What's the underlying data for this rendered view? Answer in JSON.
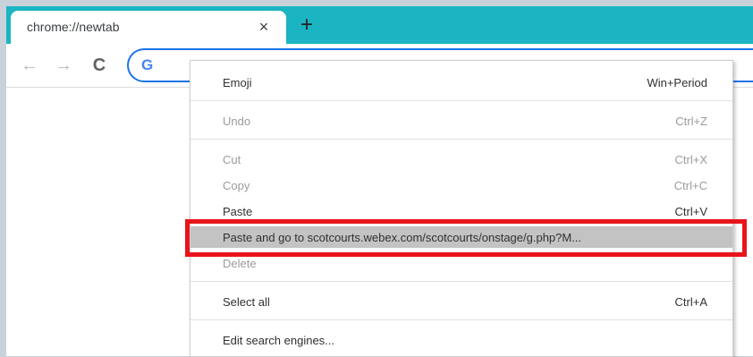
{
  "tab": {
    "title": "chrome://newtab",
    "close_symbol": "×"
  },
  "newtab_symbol": "+",
  "nav": {
    "back": "←",
    "forward": "→",
    "reload": "C"
  },
  "omnibox": {
    "logo": "G"
  },
  "context_menu": {
    "items": [
      {
        "label": "Emoji",
        "shortcut": "Win+Period"
      },
      {
        "label": "Undo",
        "shortcut": "Ctrl+Z",
        "disabled": true
      },
      {
        "label": "Cut",
        "shortcut": "Ctrl+X",
        "disabled": true
      },
      {
        "label": "Copy",
        "shortcut": "Ctrl+C",
        "disabled": true
      },
      {
        "label": "Paste",
        "shortcut": "Ctrl+V"
      },
      {
        "label": "Paste and go to scotcourts.webex.com/scotcourts/onstage/g.php?M...",
        "shortcut": "",
        "highlighted": true
      },
      {
        "label": "Delete",
        "shortcut": "",
        "disabled": true
      },
      {
        "label": "Select all",
        "shortcut": "Ctrl+A"
      },
      {
        "label": "Edit search engines...",
        "shortcut": ""
      }
    ]
  },
  "colors": {
    "tabstrip": "#1bb4c2",
    "highlight_outline": "#e8141b",
    "menu_highlight": "#c3c3c3",
    "focus_ring": "#1a73e8"
  }
}
